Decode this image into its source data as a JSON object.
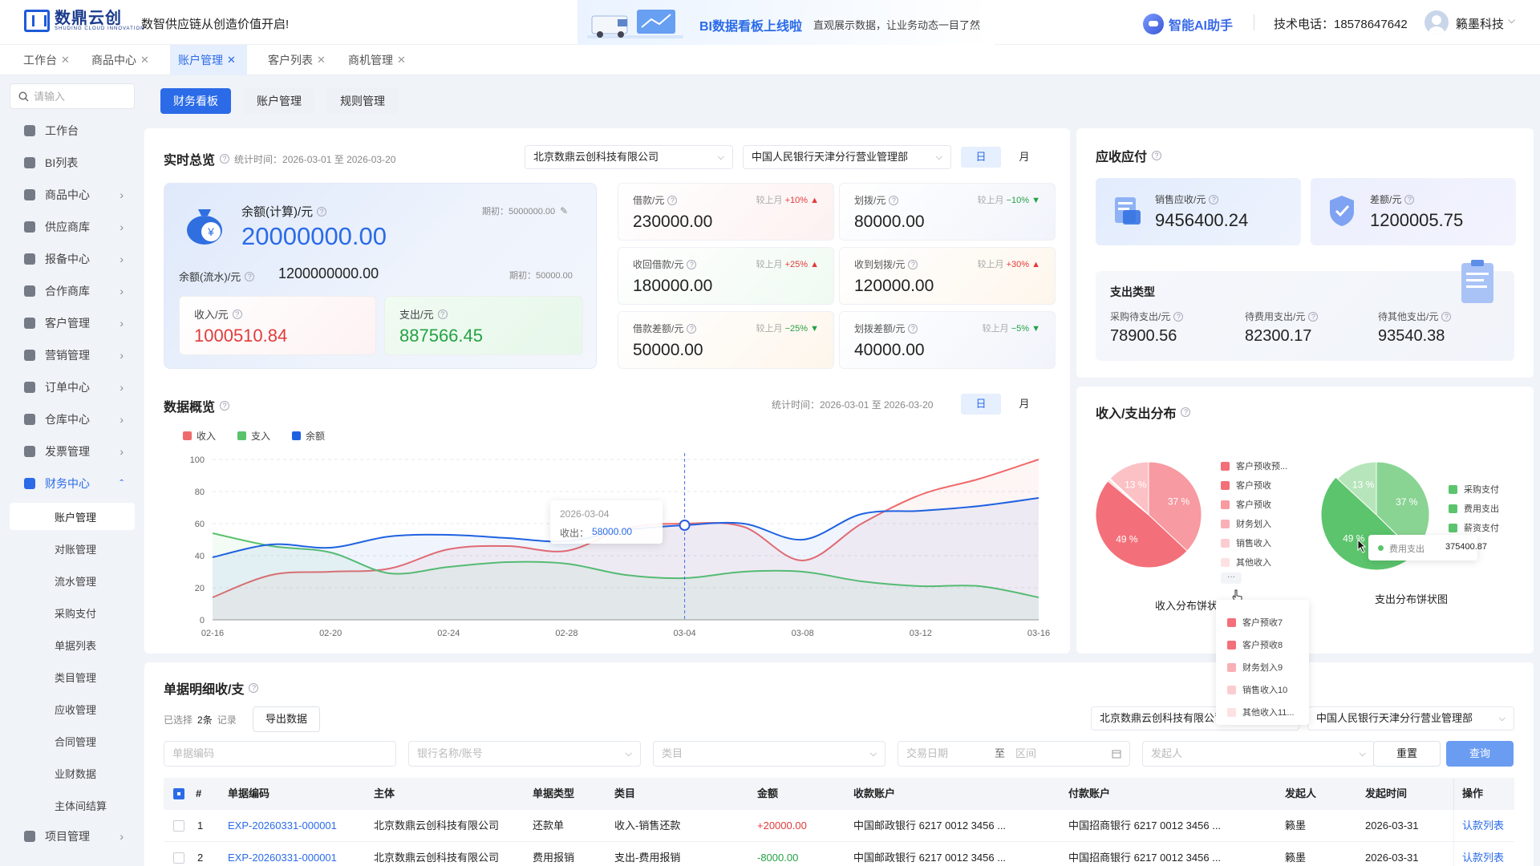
{
  "header": {
    "logo_text": "数鼎云创",
    "logo_sub": "SHUDING CLOUD INNOVATION",
    "slogan": "数智供应链从创造价值开启!",
    "banner_title": "BI数据看板上线啦",
    "banner_sub": "直观展示数据，让业务动态一目了然",
    "ai_label": "智能AI助手",
    "phone": "技术电话：18578647642",
    "user": "籁墨科技"
  },
  "tabs": [
    {
      "label": "工作台"
    },
    {
      "label": "商品中心"
    },
    {
      "label": "账户管理"
    },
    {
      "label": "客户列表"
    },
    {
      "label": "商机管理"
    }
  ],
  "sidebar": {
    "search_placeholder": "请输入",
    "items": [
      {
        "label": "工作台"
      },
      {
        "label": "BI列表"
      },
      {
        "label": "商品中心"
      },
      {
        "label": "供应商库"
      },
      {
        "label": "报备中心"
      },
      {
        "label": "合作商库"
      },
      {
        "label": "客户管理"
      },
      {
        "label": "营销管理"
      },
      {
        "label": "订单中心"
      },
      {
        "label": "仓库中心"
      },
      {
        "label": "发票管理"
      },
      {
        "label": "财务中心"
      }
    ],
    "sub_items": [
      {
        "label": "账户管理"
      },
      {
        "label": "对账管理"
      },
      {
        "label": "流水管理"
      },
      {
        "label": "采购支付"
      },
      {
        "label": "单据列表"
      },
      {
        "label": "类目管理"
      },
      {
        "label": "应收管理"
      },
      {
        "label": "合同管理"
      },
      {
        "label": "业财数据"
      },
      {
        "label": "主体间结算"
      }
    ],
    "after_items": [
      {
        "label": "项目管理"
      }
    ]
  },
  "content_tabs": [
    {
      "label": "财务看板"
    },
    {
      "label": "账户管理"
    },
    {
      "label": "规则管理"
    }
  ],
  "overview": {
    "title": "实时总览",
    "stat_time": "统计时间：2026-03-01 至 2026-03-20",
    "company": "北京数鼎云创科技有限公司",
    "bank": "中国人民银行天津分行营业管理部",
    "day": "日",
    "month": "月",
    "balance_label": "余额(计算)/元",
    "balance_value": "20000000.00",
    "balance_initial": "期初：5000000.00",
    "flow_label": "余额(流水)/元",
    "flow_value": "1200000000.00",
    "flow_initial": "期初：50000.00",
    "income_label": "收入/元",
    "income_value": "1000510.84",
    "expense_label": "支出/元",
    "expense_value": "887566.45",
    "cmp_prefix": "较上月",
    "stats": [
      {
        "label": "借款/元",
        "value": "230000.00",
        "change": "+10%",
        "trend": "▲"
      },
      {
        "label": "划拨/元",
        "value": "80000.00",
        "change": "−10%",
        "trend": "▼"
      },
      {
        "label": "收回借款/元",
        "value": "180000.00",
        "change": "+25%",
        "trend": "▲"
      },
      {
        "label": "收到划拨/元",
        "value": "120000.00",
        "change": "+30%",
        "trend": "▲"
      },
      {
        "label": "借款差额/元",
        "value": "50000.00",
        "change": "−25%",
        "trend": "▼"
      },
      {
        "label": "划拨差额/元",
        "value": "40000.00",
        "change": "−5%",
        "trend": "▼"
      }
    ]
  },
  "receivable": {
    "title": "应收应付",
    "sales_label": "销售应收/元",
    "sales_value": "9456400.24",
    "diff_label": "差额/元",
    "diff_value": "1200005.75",
    "expense_type_title": "支出类型",
    "types": [
      {
        "label": "采购待支出/元",
        "value": "78900.56"
      },
      {
        "label": "待费用支出/元",
        "value": "82300.17"
      },
      {
        "label": "待其他支出/元",
        "value": "93540.38"
      }
    ]
  },
  "data_overview": {
    "title": "数据概览",
    "stat_time": "统计时间：2026-03-01 至 2026-03-20",
    "day": "日",
    "month": "月",
    "tooltip_date": "2026-03-04",
    "tooltip_label": "收出：",
    "tooltip_value": "58000.00"
  },
  "chart_data": [
    {
      "type": "line",
      "x": [
        "02-16",
        "02-18",
        "02-20",
        "02-22",
        "02-24",
        "02-26",
        "02-28",
        "03-02",
        "03-04",
        "03-06",
        "03-08",
        "03-10",
        "03-12",
        "03-14",
        "03-16"
      ],
      "xticks": [
        "02-16",
        "02-20",
        "02-24",
        "02-28",
        "03-04",
        "03-08",
        "03-12",
        "03-16"
      ],
      "ylim": [
        0,
        100
      ],
      "yticks": [
        0,
        20,
        40,
        60,
        80,
        100
      ],
      "grid": true,
      "legend": "top-left",
      "series": [
        {
          "name": "收入",
          "color": "#ef6b6b",
          "values": [
            14,
            28,
            30,
            32,
            44,
            46,
            43,
            57,
            60,
            58,
            37,
            60,
            78,
            88,
            100
          ]
        },
        {
          "name": "支入",
          "color": "#5ac26b",
          "values": [
            54,
            46,
            42,
            29,
            33,
            36,
            35,
            28,
            26,
            30,
            30,
            24,
            21,
            21,
            14
          ]
        },
        {
          "name": "余额",
          "color": "#1f62e0",
          "values": [
            39,
            47,
            45,
            52,
            53,
            51,
            49,
            56,
            59,
            60,
            50,
            66,
            68,
            71,
            76
          ]
        }
      ]
    },
    {
      "type": "pie",
      "title": "收入分布饼状图",
      "labels": [
        "客户预收预...",
        "客户预收",
        "客户预收",
        "财务划入",
        "销售收入",
        "其他收入"
      ],
      "values": [
        49,
        37,
        13,
        0.5,
        0.3,
        0.2
      ],
      "colors": [
        "#f36f79",
        "#f79aa1",
        "#fbc1c5",
        "#f8b0b5",
        "#fbcdd0",
        "#fde1e3"
      ],
      "slice_labels": [
        "49 %",
        "37 %",
        "13 %"
      ]
    },
    {
      "type": "pie",
      "title": "支出分布饼状图",
      "labels": [
        "采购支付",
        "费用支出",
        "薪资支付"
      ],
      "values": [
        49,
        37,
        13
      ],
      "colors": [
        "#5cc46d",
        "#8ad493",
        "#b7e5bb"
      ],
      "slice_labels": [
        "49 %",
        "37 %",
        "13 %"
      ]
    }
  ],
  "distribution": {
    "title": "收入/支出分布",
    "more": "···",
    "income_more": [
      "客户预收7",
      "客户预收8",
      "财务划入9",
      "销售收入10",
      "其他收入11..."
    ],
    "tooltip_label": "费用支出",
    "tooltip_value": "375400.87"
  },
  "details": {
    "title": "单据明细收/支",
    "selected_prefix": "已选择",
    "selected_count": "2条",
    "selected_suffix": "记录",
    "export": "导出数据",
    "company": "北京数鼎云创科技有限公司",
    "bank": "中国人民银行天津分行营业管理部",
    "ph_code": "单据编码",
    "ph_bank": "银行名称/账号",
    "ph_category": "类目",
    "ph_date": "交易日期",
    "date_to": "至",
    "ph_range": "区间",
    "ph_initiator": "发起人",
    "reset": "重置",
    "query": "查询",
    "columns": [
      "#",
      "单据编码",
      "主体",
      "单据类型",
      "类目",
      "金额",
      "收款账户",
      "付款账户",
      "发起人",
      "发起时间",
      "操作"
    ],
    "rows": [
      {
        "no": "1",
        "code": "EXP-20260331-000001",
        "entity": "北京数鼎云创科技有限公司",
        "type": "还款单",
        "category": "收入-销售还款",
        "amount": "+20000.00",
        "payee": "中国邮政银行 6217 0012 3456 ...",
        "payer": "中国招商银行 6217 0012 3456 ...",
        "initiator": "籁墨",
        "time": "2026-03-31",
        "action": "认款列表"
      },
      {
        "no": "2",
        "code": "EXP-20260331-000001",
        "entity": "北京数鼎云创科技有限公司",
        "type": "费用报销",
        "category": "支出-费用报销",
        "amount": "-8000.00",
        "payee": "中国邮政银行 6217 0012 3456 ...",
        "payer": "中国招商银行 6217 0012 3456 ...",
        "initiator": "籁墨",
        "time": "2026-03-31",
        "action": "认款列表"
      }
    ]
  }
}
